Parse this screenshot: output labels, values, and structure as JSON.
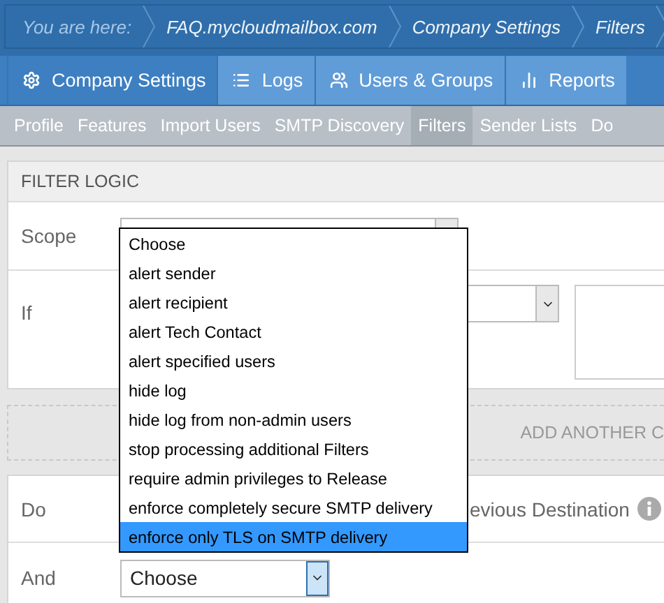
{
  "breadcrumb": [
    {
      "label": "You are here:",
      "kind": "lead"
    },
    {
      "label": "FAQ.mycloudmailbox.com",
      "kind": "crumb"
    },
    {
      "label": "Company Settings",
      "kind": "crumb"
    },
    {
      "label": "Filters",
      "kind": "crumb"
    }
  ],
  "nav_tabs": [
    {
      "label": "Company Settings",
      "selected": true
    },
    {
      "label": "Logs",
      "selected": false
    },
    {
      "label": "Users & Groups",
      "selected": false
    },
    {
      "label": "Reports",
      "selected": false
    }
  ],
  "subnav": [
    {
      "label": "Profile",
      "selected": false
    },
    {
      "label": "Features",
      "selected": false
    },
    {
      "label": "Import Users",
      "selected": false
    },
    {
      "label": "SMTP Discovery",
      "selected": false
    },
    {
      "label": "Filters",
      "selected": true
    },
    {
      "label": "Sender Lists",
      "selected": false
    },
    {
      "label": "Do",
      "selected": false
    }
  ],
  "filter_logic": {
    "title": "FILTER LOGIC",
    "scope_label": "Scope",
    "if_label": "If"
  },
  "add_condition": "ADD ANOTHER C",
  "actions": {
    "do_label": "Do",
    "do_value": "evious Destination",
    "and_label": "And",
    "and_value": "Choose"
  },
  "dropdown": {
    "options": [
      {
        "label": "Choose",
        "selected": false
      },
      {
        "label": "alert sender",
        "selected": false
      },
      {
        "label": "alert recipient",
        "selected": false
      },
      {
        "label": "alert Tech Contact",
        "selected": false
      },
      {
        "label": "alert specified users",
        "selected": false
      },
      {
        "label": "hide log",
        "selected": false
      },
      {
        "label": "hide log from non-admin users",
        "selected": false
      },
      {
        "label": "stop processing additional Filters",
        "selected": false
      },
      {
        "label": "require admin privileges to Release",
        "selected": false
      },
      {
        "label": "enforce completely secure SMTP delivery",
        "selected": false
      },
      {
        "label": "enforce only TLS on SMTP delivery",
        "selected": true
      }
    ]
  }
}
